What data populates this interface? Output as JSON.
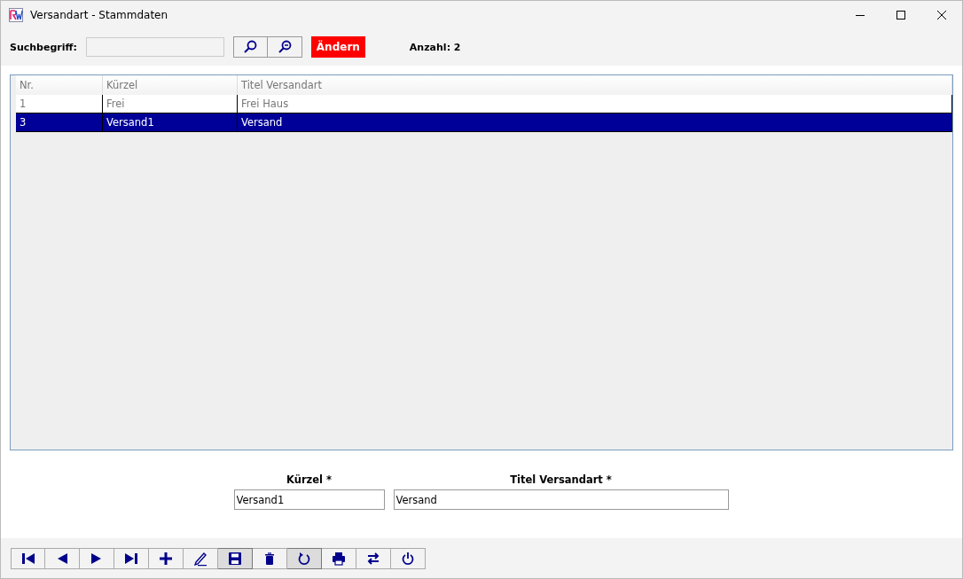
{
  "window": {
    "title": "Versandart - Stammdaten"
  },
  "search": {
    "label": "Suchbegriff:",
    "action": "Ändern",
    "count": "Anzahl: 2"
  },
  "table": {
    "columns": [
      "Nr.",
      "Kürzel",
      "Titel Versandart"
    ],
    "rows": [
      {
        "cells": [
          "1",
          "Frei",
          "Frei Haus"
        ],
        "selected": false
      },
      {
        "cells": [
          "3",
          "Versand1",
          "Versand"
        ],
        "selected": true
      }
    ]
  },
  "form": {
    "fields": [
      {
        "label": "Kürzel *",
        "value": "Versand1"
      },
      {
        "label": "Titel Versandart *",
        "value": "Versand"
      }
    ]
  },
  "toolbar": [
    {
      "kind": "first",
      "pressed": false
    },
    {
      "kind": "prev",
      "pressed": false
    },
    {
      "kind": "next",
      "pressed": false
    },
    {
      "kind": "last",
      "pressed": false
    },
    {
      "kind": "add",
      "pressed": false
    },
    {
      "kind": "edit",
      "pressed": false
    },
    {
      "kind": "save",
      "pressed": true
    },
    {
      "kind": "delete",
      "pressed": false
    },
    {
      "kind": "undo",
      "pressed": true
    },
    {
      "kind": "print",
      "pressed": false
    },
    {
      "kind": "swap",
      "pressed": false
    },
    {
      "kind": "power",
      "pressed": false
    }
  ]
}
